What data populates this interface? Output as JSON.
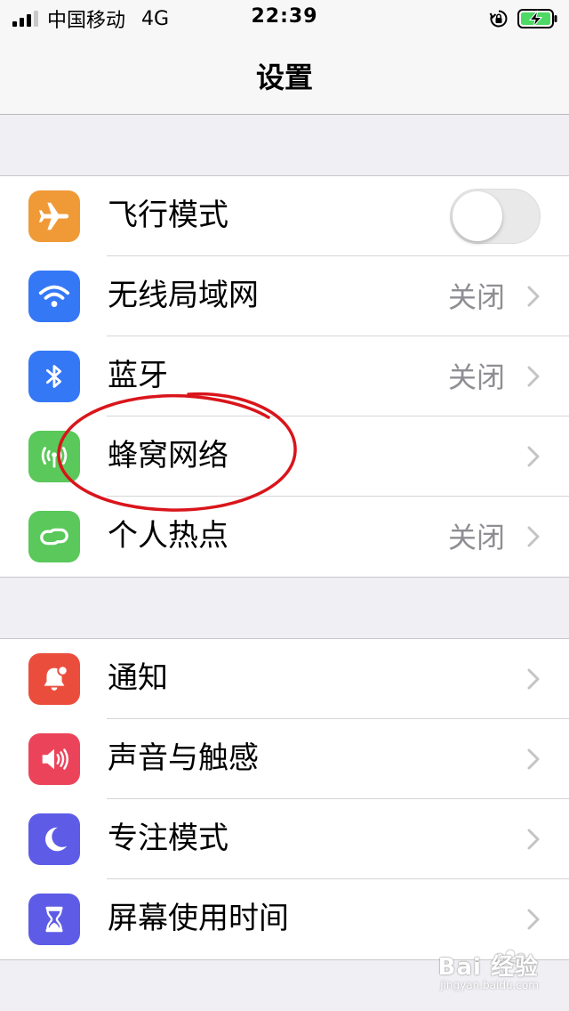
{
  "status_bar": {
    "carrier": "中国移动",
    "network": "4G",
    "time": "22:39"
  },
  "nav": {
    "title": "设置"
  },
  "groups": [
    {
      "rows": [
        {
          "label": "飞行模式",
          "icon": "airplane-icon",
          "icon_color": "#f09a37",
          "control": "toggle",
          "toggle_on": false
        },
        {
          "label": "无线局域网",
          "icon": "wifi-icon",
          "icon_color": "#3478f6",
          "detail": "关闭"
        },
        {
          "label": "蓝牙",
          "icon": "bluetooth-icon",
          "icon_color": "#3478f6",
          "detail": "关闭"
        },
        {
          "label": "蜂窝网络",
          "icon": "cellular-icon",
          "icon_color": "#5ac85a",
          "detail": ""
        },
        {
          "label": "个人热点",
          "icon": "hotspot-icon",
          "icon_color": "#5ac85a",
          "detail": "关闭"
        }
      ]
    },
    {
      "rows": [
        {
          "label": "通知",
          "icon": "notification-icon",
          "icon_color": "#eb4d3d"
        },
        {
          "label": "声音与触感",
          "icon": "sound-icon",
          "icon_color": "#eb445a"
        },
        {
          "label": "专注模式",
          "icon": "moon-icon",
          "icon_color": "#5e5ce6"
        },
        {
          "label": "屏幕使用时间",
          "icon": "hourglass-icon",
          "icon_color": "#5e5ce6"
        }
      ]
    }
  ],
  "annotation_color": "#d9151b",
  "watermark": {
    "text": "Bai 经验",
    "sub": "jingyan.baidu.com"
  }
}
